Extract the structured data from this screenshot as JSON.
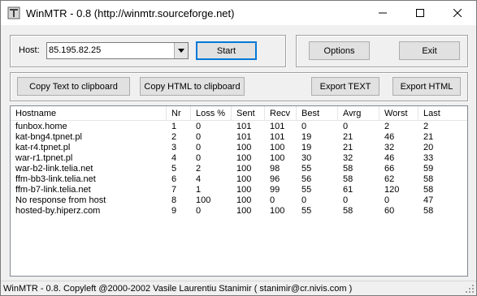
{
  "window": {
    "title": "WinMTR - 0.8 (http://winmtr.sourceforge.net)"
  },
  "host": {
    "label": "Host:",
    "value": "85.195.82.25"
  },
  "buttons": {
    "start": "Start",
    "options": "Options",
    "exit": "Exit",
    "copy_text": "Copy Text to clipboard",
    "copy_html": "Copy HTML to clipboard",
    "export_text": "Export TEXT",
    "export_html": "Export HTML"
  },
  "table": {
    "columns": [
      "Hostname",
      "Nr",
      "Loss %",
      "Sent",
      "Recv",
      "Best",
      "Avrg",
      "Worst",
      "Last"
    ],
    "rows": [
      [
        "funbox.home",
        "1",
        "0",
        "101",
        "101",
        "0",
        "0",
        "2",
        "2"
      ],
      [
        "kat-bng4.tpnet.pl",
        "2",
        "0",
        "101",
        "101",
        "19",
        "21",
        "46",
        "21"
      ],
      [
        "kat-r4.tpnet.pl",
        "3",
        "0",
        "100",
        "100",
        "19",
        "21",
        "32",
        "20"
      ],
      [
        "war-r1.tpnet.pl",
        "4",
        "0",
        "100",
        "100",
        "30",
        "32",
        "46",
        "33"
      ],
      [
        "war-b2-link.telia.net",
        "5",
        "2",
        "100",
        "98",
        "55",
        "58",
        "66",
        "59"
      ],
      [
        "ffm-bb3-link.telia.net",
        "6",
        "4",
        "100",
        "96",
        "56",
        "58",
        "62",
        "58"
      ],
      [
        "ffm-b7-link.telia.net",
        "7",
        "1",
        "100",
        "99",
        "55",
        "61",
        "120",
        "58"
      ],
      [
        "No response from host",
        "8",
        "100",
        "100",
        "0",
        "0",
        "0",
        "0",
        "47"
      ],
      [
        "hosted-by.hiperz.com",
        "9",
        "0",
        "100",
        "100",
        "55",
        "58",
        "60",
        "58"
      ]
    ]
  },
  "status": {
    "text": "WinMTR - 0.8. Copyleft @2000-2002 Vasile Laurentiu Stanimir  ( stanimir@cr.nivis.com )"
  },
  "icons": {
    "app": "winmtr-app-icon",
    "minimize": "minimize-icon",
    "maximize": "maximize-icon",
    "close": "close-icon",
    "dropdown": "chevron-down-icon",
    "grip": "resize-grip-icon"
  }
}
